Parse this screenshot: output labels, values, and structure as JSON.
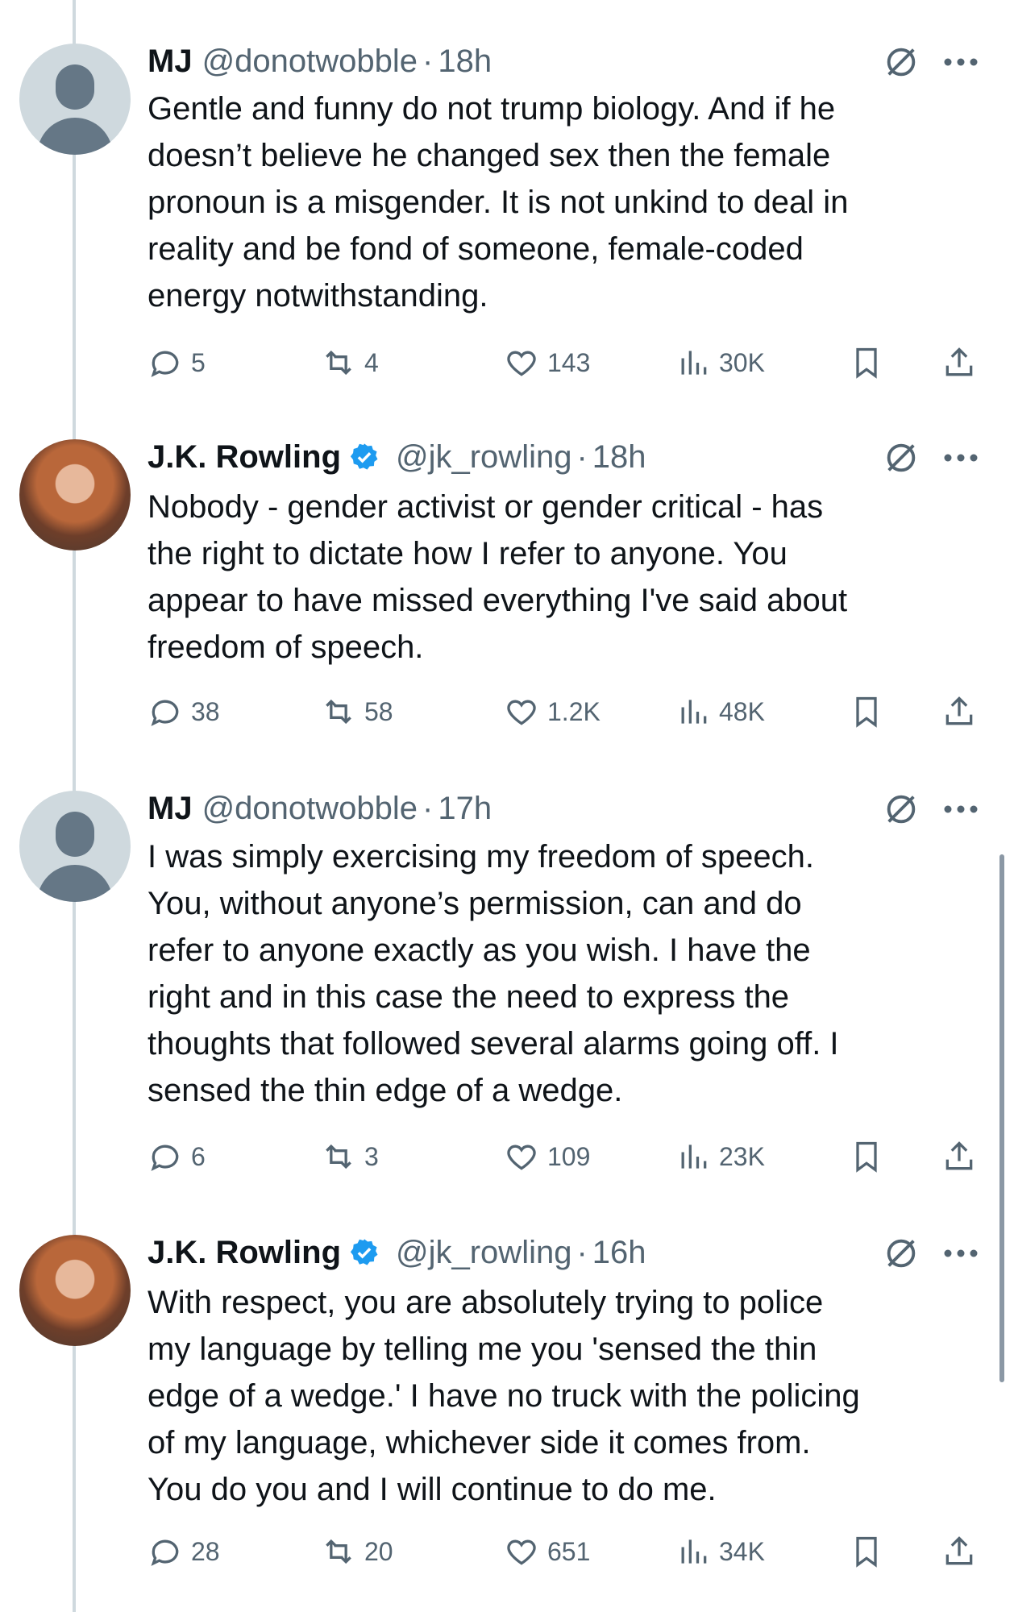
{
  "tweets": [
    {
      "author": "MJ",
      "handle": "@donotwobble",
      "separator": "·",
      "time": "18h",
      "verified": false,
      "avatar": "default-avatar",
      "text": "Gentle and funny do not trump biology. And if he\ndoesn’t believe he changed sex then the female\npronoun is a misgender. It is not unkind to deal in\nreality and be fond of someone, female-coded\nenergy notwithstanding.",
      "replies": "5",
      "reposts": "4",
      "likes": "143",
      "views": "30K"
    },
    {
      "author": "J.K. Rowling",
      "handle": "@jk_rowling",
      "separator": "·",
      "time": "18h",
      "verified": true,
      "avatar": "profile-photo",
      "text": "Nobody - gender activist or gender critical - has\nthe right to dictate how I refer to anyone. You\nappear to have missed everything I've said about\nfreedom of speech.",
      "replies": "38",
      "reposts": "58",
      "likes": "1.2K",
      "views": "48K"
    },
    {
      "author": "MJ",
      "handle": "@donotwobble",
      "separator": "·",
      "time": "17h",
      "verified": false,
      "avatar": "default-avatar",
      "text": "I was simply exercising my freedom of speech.\nYou, without anyone’s permission, can and do\nrefer to anyone exactly as you wish. I have the\nright and in this case the need to express the\nthoughts that followed several alarms going off. I\nsensed the thin edge of a wedge.",
      "replies": "6",
      "reposts": "3",
      "likes": "109",
      "views": "23K"
    },
    {
      "author": "J.K. Rowling",
      "handle": "@jk_rowling",
      "separator": "·",
      "time": "16h",
      "verified": true,
      "avatar": "profile-photo",
      "text": "With respect, you are absolutely trying to police\nmy language by telling me you 'sensed the thin\nedge of a wedge.' I have no truck with the policing\nof my language, whichever side it comes from.\nYou do you and I will continue to do me.",
      "replies": "28",
      "reposts": "20",
      "likes": "651",
      "views": "34K"
    }
  ],
  "icons": {
    "reply": "reply-icon",
    "repost": "repost-icon",
    "like": "like-icon",
    "views": "views-icon",
    "bookmark": "bookmark-icon",
    "share": "share-icon",
    "grok": "grok-icon",
    "more": "more-icon",
    "verified": "verified-badge-icon"
  },
  "colors": {
    "text": "#0f1419",
    "secondary": "#536471",
    "verified": "#1d9bf0",
    "thread_line": "#cfd9de"
  }
}
